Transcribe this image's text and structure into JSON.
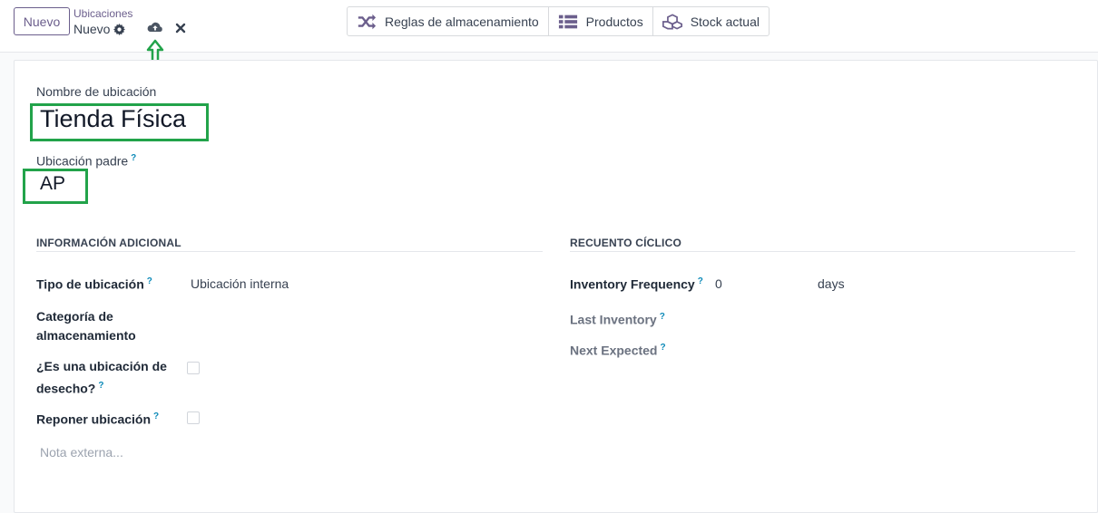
{
  "header": {
    "new_button_label": "Nuevo",
    "breadcrumb_parent": "Ubicaciones",
    "breadcrumb_current": "Nuevo"
  },
  "smart_buttons": [
    {
      "label": "Reglas de almacenamiento",
      "icon": "shuffle-icon"
    },
    {
      "label": "Productos",
      "icon": "list-icon"
    },
    {
      "label": "Stock actual",
      "icon": "cubes-icon"
    }
  ],
  "form": {
    "name_label": "Nombre de ubicación",
    "name_value": "Tienda Física",
    "parent_label": "Ubicación padre",
    "parent_value": "AP",
    "help_mark": "?"
  },
  "additional_info": {
    "title": "INFORMACIÓN ADICIONAL",
    "type_label": "Tipo de ubicación",
    "type_value": "Ubicación interna",
    "storage_category_label": "Categoría de almacenamiento",
    "scrap_label_line1": "¿Es una ubicación de",
    "scrap_label_line2": "desecho?",
    "scrap_checked": false,
    "replenish_label": "Reponer ubicación",
    "replenish_checked": false,
    "note_placeholder": "Nota externa..."
  },
  "cyclic_count": {
    "title": "RECUENTO CÍCLICO",
    "frequency_label": "Inventory Frequency",
    "frequency_value": "0",
    "frequency_unit": "days",
    "last_inventory_label": "Last Inventory",
    "next_expected_label": "Next Expected"
  },
  "colors": {
    "brand": "#6b5e8c",
    "highlight": "#22a34a",
    "help": "#0d8ab8"
  }
}
